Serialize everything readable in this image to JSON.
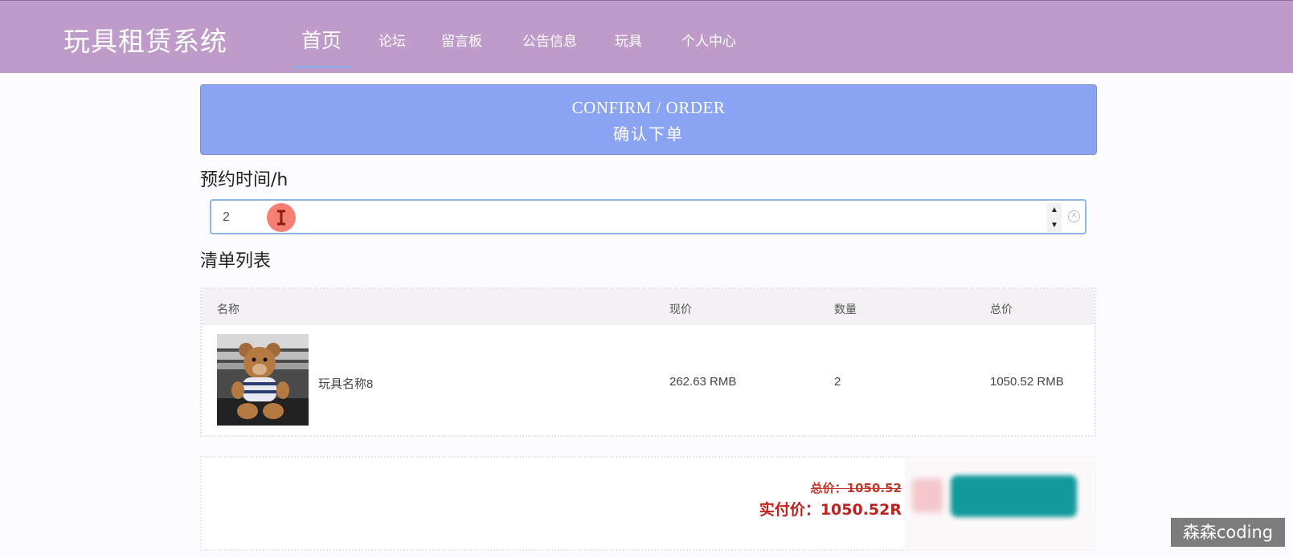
{
  "header": {
    "brand": "玩具租赁系统",
    "nav": [
      "首页",
      "论坛",
      "留言板",
      "公告信息",
      "玩具",
      "个人中心"
    ],
    "active_index": 0
  },
  "banner": {
    "title_en": "CONFIRM / ORDER",
    "title_cn": "确认下单"
  },
  "reservation": {
    "label": "预约时间/h",
    "value": "2"
  },
  "list": {
    "label": "清单列表",
    "columns": [
      "名称",
      "现价",
      "数量",
      "总价"
    ],
    "rows": [
      {
        "name": "玩具名称8",
        "price": "262.63 RMB",
        "qty": "2",
        "total": "1050.52 RMB"
      }
    ]
  },
  "summary": {
    "total_label": "总价：1050.52",
    "pay_label": "实付价：1050.52R"
  },
  "watermark": "森森coding",
  "colors": {
    "header": "#bf9bc9",
    "banner": "#8aa3f2",
    "accent_red": "#c0211a",
    "button_teal": "#129a9c"
  }
}
